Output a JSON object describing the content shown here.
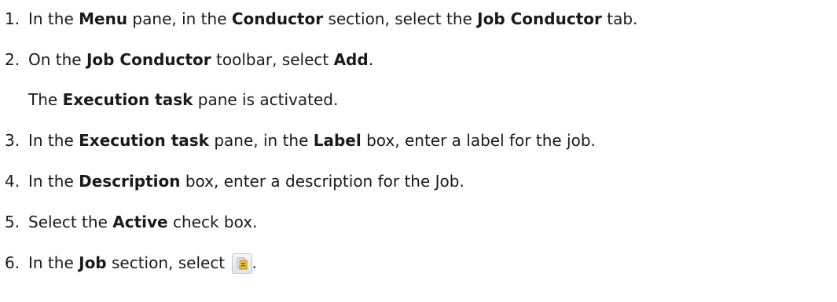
{
  "steps": [
    {
      "n": "1.",
      "t1": "In the ",
      "b1": "Menu",
      "t2": " pane, in the ",
      "b2": "Conductor",
      "t3": " section, select the ",
      "b3": "Job Conductor",
      "t4": " tab."
    },
    {
      "n": "2.",
      "t1": "On the ",
      "b1": "Job Conductor",
      "t2": " toolbar, select ",
      "b2": "Add",
      "t3": "."
    },
    {
      "note_t1": "The ",
      "note_b1": "Execution task",
      "note_t2": " pane is activated."
    },
    {
      "n": "3.",
      "t1": "In the ",
      "b1": "Execution task",
      "t2": " pane, in the ",
      "b2": "Label",
      "t3": " box, enter a label for the job."
    },
    {
      "n": "4.",
      "t1": "In the ",
      "b1": "Description",
      "t2": " box, enter a description for the Job."
    },
    {
      "n": "5.",
      "t1": "Select the ",
      "b1": "Active",
      "t2": " check box."
    },
    {
      "n": "6.",
      "t1": "In the ",
      "b1": "Job",
      "t2": " section, select ",
      "t3": "."
    }
  ],
  "icons": {
    "step6": "job-select-icon"
  }
}
